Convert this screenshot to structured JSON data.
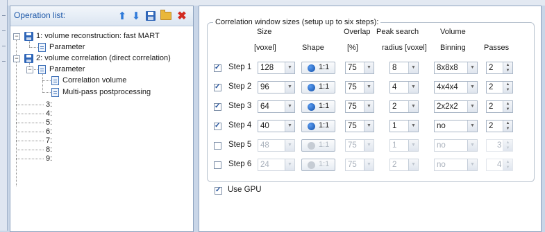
{
  "operation_list": {
    "title": "Operation list:",
    "toolbar": [
      {
        "name": "move-up-icon",
        "glyph": "⬆",
        "color": "#2f7ad9"
      },
      {
        "name": "move-down-icon",
        "glyph": "⬇",
        "color": "#2f7ad9"
      },
      {
        "name": "save-icon",
        "glyph": "",
        "color": "#2f66b8"
      },
      {
        "name": "open-folder-icon",
        "glyph": "",
        "color": "#e9b73a"
      },
      {
        "name": "delete-icon",
        "glyph": "✖",
        "color": "#d22b22"
      }
    ],
    "tree": {
      "op1": "1: volume reconstruction: fast MART",
      "op1_param": "Parameter",
      "op2": "2: volume correlation (direct correlation)",
      "op2_param": "Parameter",
      "op2_corr": "Correlation volume",
      "op2_multi": "Multi-pass postprocessing",
      "empty_slots": [
        "3:",
        "4:",
        "5:",
        "6:",
        "7:",
        "8:",
        "9:"
      ]
    }
  },
  "correlation": {
    "group_title": "Correlation window sizes (setup up to six steps):",
    "headers": {
      "size_top": "Size",
      "size_bottom": "[voxel]",
      "shape": "Shape",
      "overlap_top": "Overlap",
      "overlap_bottom": "[%]",
      "peak_top": "Peak search",
      "peak_bottom": "radius [voxel]",
      "binning_top": "Volume",
      "binning_bottom": "Binning",
      "passes": "Passes"
    },
    "steps": [
      {
        "label": "Step 1",
        "checked": true,
        "size": "128",
        "shape": "1:1",
        "overlap": "75",
        "peak": "8",
        "binning": "8x8x8",
        "passes": "2"
      },
      {
        "label": "Step 2",
        "checked": true,
        "size": "96",
        "shape": "1:1",
        "overlap": "75",
        "peak": "4",
        "binning": "4x4x4",
        "passes": "2"
      },
      {
        "label": "Step 3",
        "checked": true,
        "size": "64",
        "shape": "1:1",
        "overlap": "75",
        "peak": "2",
        "binning": "2x2x2",
        "passes": "2"
      },
      {
        "label": "Step 4",
        "checked": true,
        "size": "40",
        "shape": "1:1",
        "overlap": "75",
        "peak": "1",
        "binning": "no",
        "passes": "2"
      },
      {
        "label": "Step 5",
        "checked": false,
        "size": "48",
        "shape": "1:1",
        "overlap": "75",
        "peak": "1",
        "binning": "no",
        "passes": "3"
      },
      {
        "label": "Step 6",
        "checked": false,
        "size": "24",
        "shape": "1:1",
        "overlap": "75",
        "peak": "2",
        "binning": "no",
        "passes": "4"
      }
    ],
    "use_gpu": {
      "label": "Use GPU",
      "checked": true
    }
  }
}
